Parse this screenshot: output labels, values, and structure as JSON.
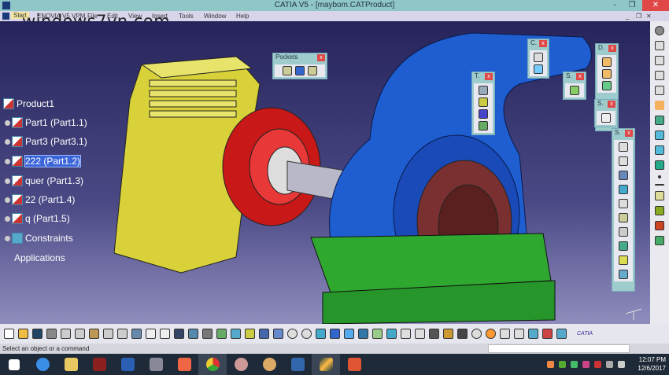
{
  "window": {
    "title": "CATIA V5 - [maybom.CATProduct]",
    "minimize": "-",
    "restore": "❐",
    "close": "✕"
  },
  "watermark": "windows7vn.com",
  "menu": [
    "Start",
    "ENOVIA V5 VPM",
    "File",
    "Edit",
    "View",
    "Insert",
    "Tools",
    "Window",
    "Help"
  ],
  "tree": {
    "root": "Product1",
    "items": [
      "Part1 (Part1.1)",
      "Part3 (Part3.1)",
      "222 (Part1.2)",
      "quer (Part1.3)",
      "22 (Part1.4)",
      "q (Part1.5)"
    ],
    "selected_index": 2,
    "constraints": "Constraints",
    "applications": "Applications"
  },
  "toolbars": {
    "pockets": "Pockets",
    "t": "T.",
    "c": "C.",
    "s1": "S.",
    "d": "D.",
    "s2": "S.",
    "s3": "S.",
    "close": "x"
  },
  "status": {
    "text": "Select an object or a command"
  },
  "logo": "CATIA",
  "clock": {
    "time": "12:07 PM",
    "date": "12/6/2017"
  }
}
